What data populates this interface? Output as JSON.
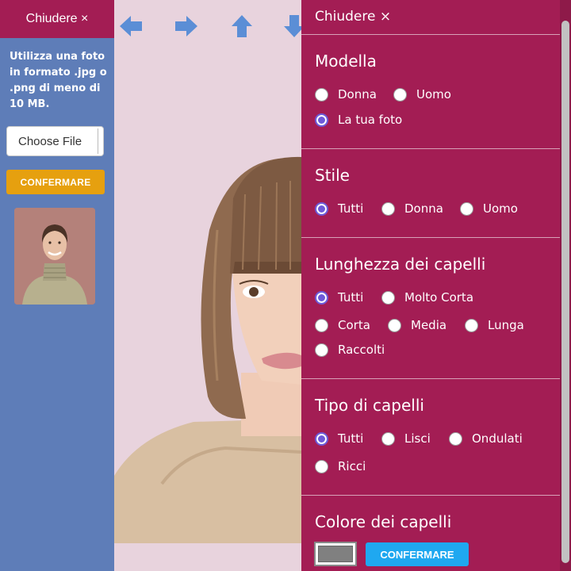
{
  "upload_panel": {
    "close_label": "Chiudere ×",
    "instruction": "Utilizza una foto in formato .jpg o .png di meno di 10 MB.",
    "file_button": "Choose File",
    "confirm_label": "CONFERMARE"
  },
  "navigation": {
    "arrows": [
      "left-arrow-icon",
      "right-arrow-icon",
      "up-arrow-icon",
      "down-arrow-icon"
    ]
  },
  "options_panel": {
    "close_label": "Chiudere ×",
    "sections": {
      "model": {
        "title": "Modella",
        "options": [
          {
            "label": "Donna",
            "selected": false
          },
          {
            "label": "Uomo",
            "selected": false
          },
          {
            "label": "La tua foto",
            "selected": true
          }
        ]
      },
      "style": {
        "title": "Stile",
        "options": [
          {
            "label": "Tutti",
            "selected": true
          },
          {
            "label": "Donna",
            "selected": false
          },
          {
            "label": "Uomo",
            "selected": false
          }
        ]
      },
      "length": {
        "title": "Lunghezza dei capelli",
        "options": [
          {
            "label": "Tutti",
            "selected": true
          },
          {
            "label": "Molto Corta",
            "selected": false
          },
          {
            "label": "Corta",
            "selected": false
          },
          {
            "label": "Media",
            "selected": false
          },
          {
            "label": "Lunga",
            "selected": false
          },
          {
            "label": "Raccolti",
            "selected": false
          }
        ]
      },
      "type": {
        "title": "Tipo di capelli",
        "options": [
          {
            "label": "Tutti",
            "selected": true
          },
          {
            "label": "Lisci",
            "selected": false
          },
          {
            "label": "Ondulati",
            "selected": false
          },
          {
            "label": "Ricci",
            "selected": false
          }
        ]
      },
      "color": {
        "title": "Colore dei capelli",
        "swatch_color": "#808080",
        "confirm_label": "CONFERMARE"
      }
    }
  },
  "colors": {
    "panel_bg": "#a31d54",
    "left_bg": "#5e7db8",
    "page_bg": "#e8d3dd",
    "confirm_orange": "#e6a00f",
    "confirm_blue": "#1fa8f0",
    "radio_selected": "#6d5ad8",
    "arrow_blue": "#5b8ed6"
  }
}
